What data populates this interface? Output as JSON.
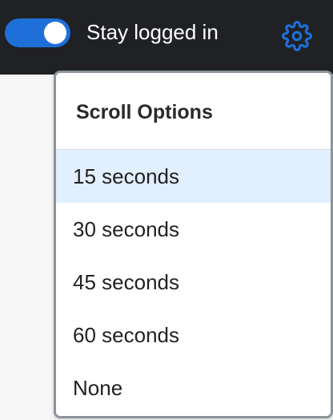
{
  "topbar": {
    "toggle": {
      "checked": true
    },
    "toggle_label": "Stay logged in",
    "gear_icon": "gear-icon",
    "accent_color": "#1f6fd9"
  },
  "dropdown": {
    "title": "Scroll Options",
    "selected_index": 0,
    "options": [
      {
        "label": "15 seconds"
      },
      {
        "label": "30 seconds"
      },
      {
        "label": "45 seconds"
      },
      {
        "label": "60 seconds"
      },
      {
        "label": "None"
      }
    ],
    "selected_color": "#e2efff"
  }
}
